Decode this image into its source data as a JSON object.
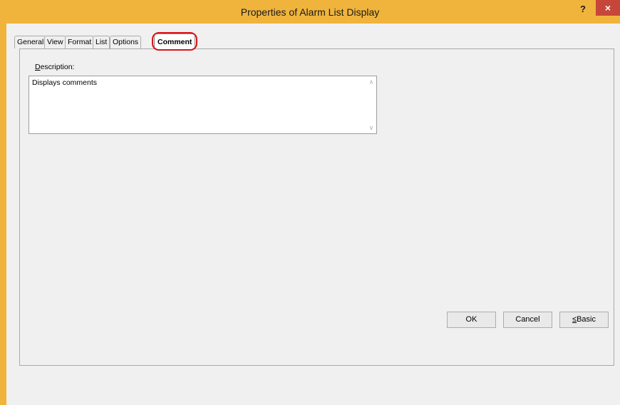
{
  "window": {
    "title": "Properties of Alarm List Display",
    "help_label": "?",
    "close_label": "×"
  },
  "tabs": [
    {
      "label": "General"
    },
    {
      "label": "View"
    },
    {
      "label": "Format"
    },
    {
      "label": "List"
    },
    {
      "label": "Options"
    },
    {
      "label": "Comment",
      "active": true
    }
  ],
  "comment_tab": {
    "description_label_prefix": "D",
    "description_label_rest": "escription:",
    "description_value": "Displays comments"
  },
  "buttons": {
    "ok": "OK",
    "cancel": "Cancel",
    "basic_prefix": "≤",
    "basic_rest": "Basic"
  }
}
